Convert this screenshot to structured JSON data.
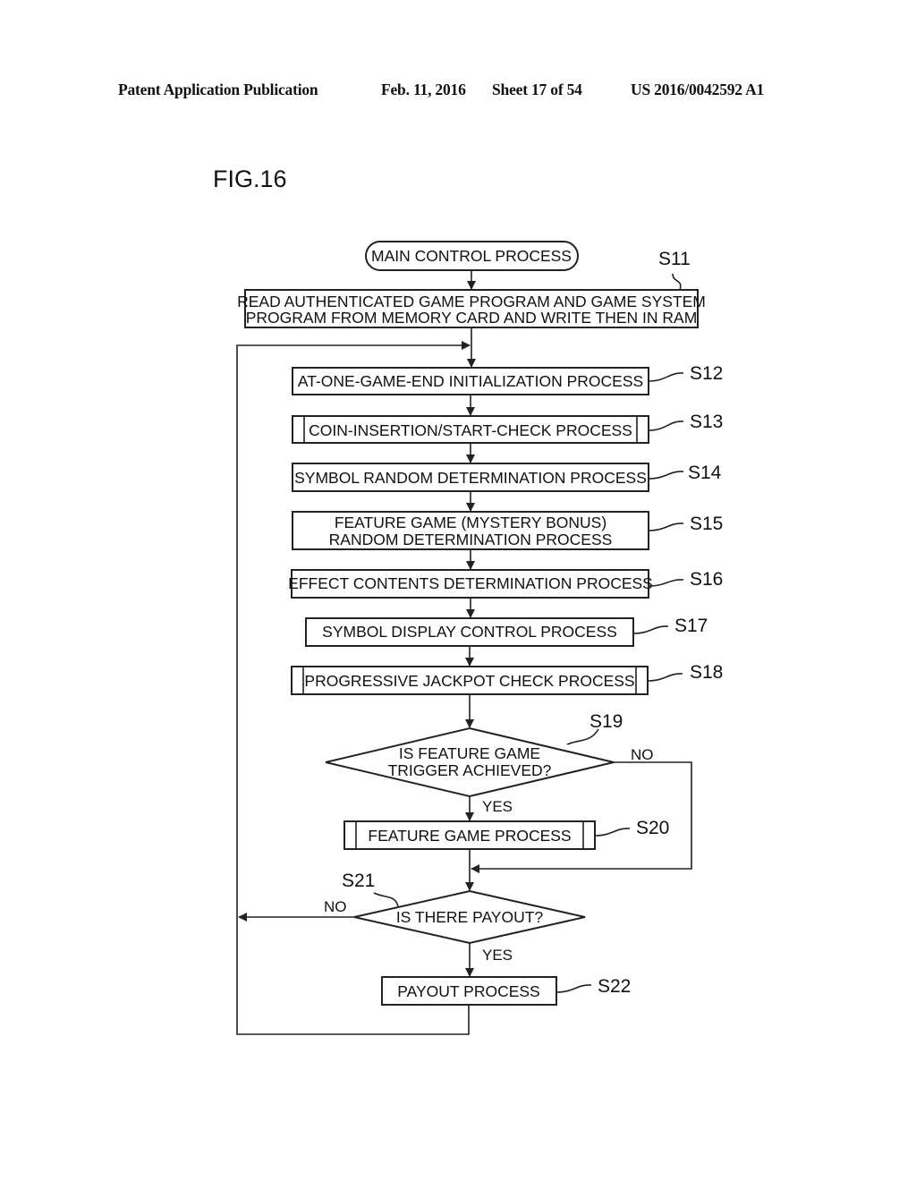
{
  "header": {
    "publication": "Patent Application Publication",
    "date": "Feb. 11, 2016",
    "sheet": "Sheet 17 of 54",
    "number": "US 2016/0042592 A1"
  },
  "figure": {
    "label": "FIG.16"
  },
  "flowchart": {
    "start": {
      "label": "MAIN CONTROL PROCESS"
    },
    "steps": {
      "s11": {
        "id": "S11",
        "lines": [
          "READ AUTHENTICATED GAME PROGRAM AND GAME SYSTEM",
          "PROGRAM FROM MEMORY CARD AND WRITE THEN IN RAM"
        ]
      },
      "s12": {
        "id": "S12",
        "lines": [
          "AT-ONE-GAME-END INITIALIZATION PROCESS"
        ]
      },
      "s13": {
        "id": "S13",
        "lines": [
          "COIN-INSERTION/START-CHECK PROCESS"
        ],
        "subroutine": true
      },
      "s14": {
        "id": "S14",
        "lines": [
          "SYMBOL RANDOM DETERMINATION PROCESS"
        ]
      },
      "s15": {
        "id": "S15",
        "lines": [
          "FEATURE GAME (MYSTERY BONUS)",
          "RANDOM DETERMINATION PROCESS"
        ]
      },
      "s16": {
        "id": "S16",
        "lines": [
          "EFFECT CONTENTS DETERMINATION PROCESS"
        ]
      },
      "s17": {
        "id": "S17",
        "lines": [
          "SYMBOL DISPLAY CONTROL PROCESS"
        ]
      },
      "s18": {
        "id": "S18",
        "lines": [
          "PROGRESSIVE JACKPOT CHECK PROCESS"
        ],
        "subroutine": true
      },
      "s19": {
        "id": "S19",
        "lines": [
          "IS FEATURE GAME",
          "TRIGGER ACHIEVED?"
        ],
        "yes": "YES",
        "no": "NO"
      },
      "s20": {
        "id": "S20",
        "lines": [
          "FEATURE GAME PROCESS"
        ],
        "subroutine": true
      },
      "s21": {
        "id": "S21",
        "lines": [
          "IS THERE PAYOUT?"
        ],
        "yes": "YES",
        "no": "NO"
      },
      "s22": {
        "id": "S22",
        "lines": [
          "PAYOUT PROCESS"
        ]
      }
    }
  }
}
